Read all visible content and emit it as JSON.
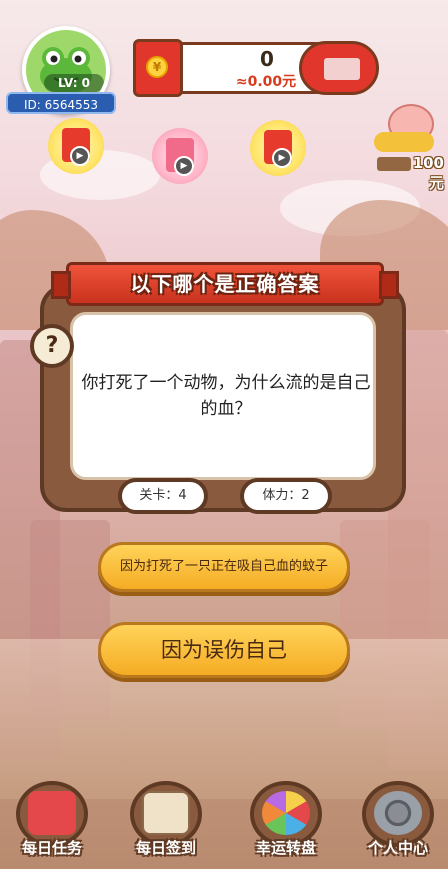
{
  "player": {
    "level": "LV: 0",
    "id": "ID: 6564553"
  },
  "wallet": {
    "coins": "0",
    "rmb": "≈0.00元"
  },
  "piggy_bank": {
    "amount": "100元"
  },
  "quiz": {
    "banner": "以下哪个是正确答案",
    "question": "你打死了一个动物，为什么流的是自己的血？",
    "level_label": "关卡：4",
    "stamina_label": "体力：2",
    "answers": [
      "因为打死了一只正在吸自己血的蚊子",
      "因为误伤自己"
    ]
  },
  "bottom_nav": [
    {
      "label": "每日任务",
      "icon": "red-envelope-gift-icon"
    },
    {
      "label": "每日签到",
      "icon": "clipboard-checkin-icon"
    },
    {
      "label": "幸运转盘",
      "icon": "lucky-wheel-icon"
    },
    {
      "label": "个人中心",
      "icon": "gear-icon"
    }
  ],
  "colors": {
    "accent_red": "#e0362c",
    "frame_brown": "#5e3a24",
    "answer_gold": "#f5ac24"
  }
}
